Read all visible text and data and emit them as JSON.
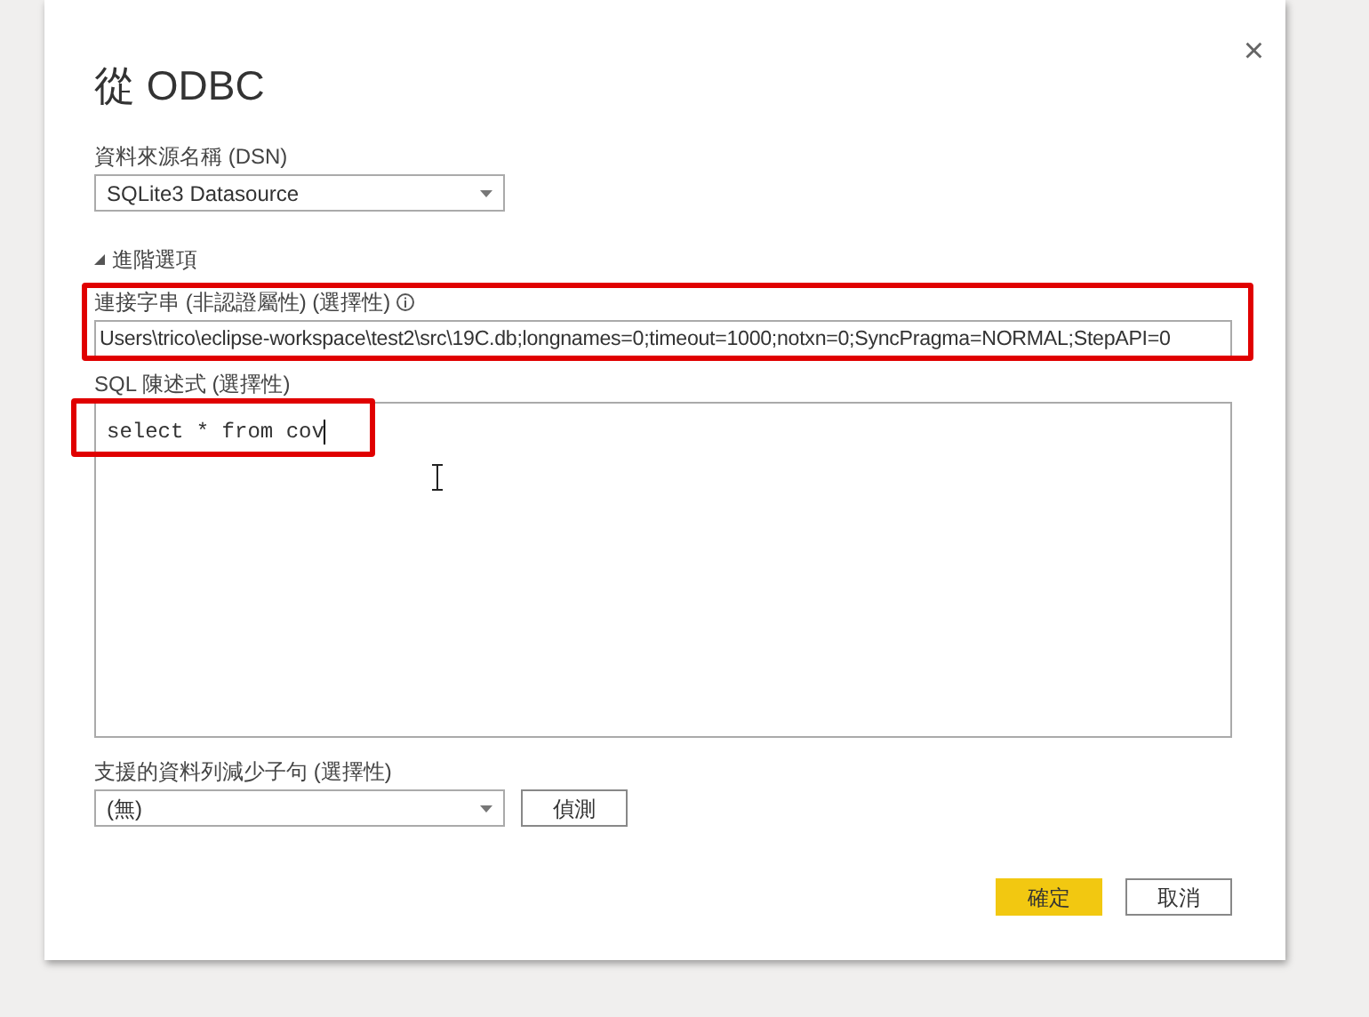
{
  "dialog": {
    "title": "從 ODBC",
    "close": "×"
  },
  "dsn": {
    "label": "資料來源名稱 (DSN)",
    "value": "SQLite3 Datasource"
  },
  "advanced": {
    "label": "進階選項",
    "expanded": true
  },
  "connection_string": {
    "label": "連接字串 (非認證屬性) (選擇性)",
    "value": "Users\\trico\\eclipse-workspace\\test2\\src\\19C.db;longnames=0;timeout=1000;notxn=0;SyncPragma=NORMAL;StepAPI=0",
    "highlighted": true
  },
  "sql": {
    "label": "SQL 陳述式 (選擇性)",
    "value": "select * from cov",
    "highlighted": true
  },
  "row_reduction": {
    "label": "支援的資料列減少子句 (選擇性)",
    "value": "(無)",
    "detect_button": "偵測"
  },
  "buttons": [
    {
      "label": "確定",
      "kind": "primary"
    },
    {
      "label": "取消",
      "kind": "secondary"
    }
  ]
}
